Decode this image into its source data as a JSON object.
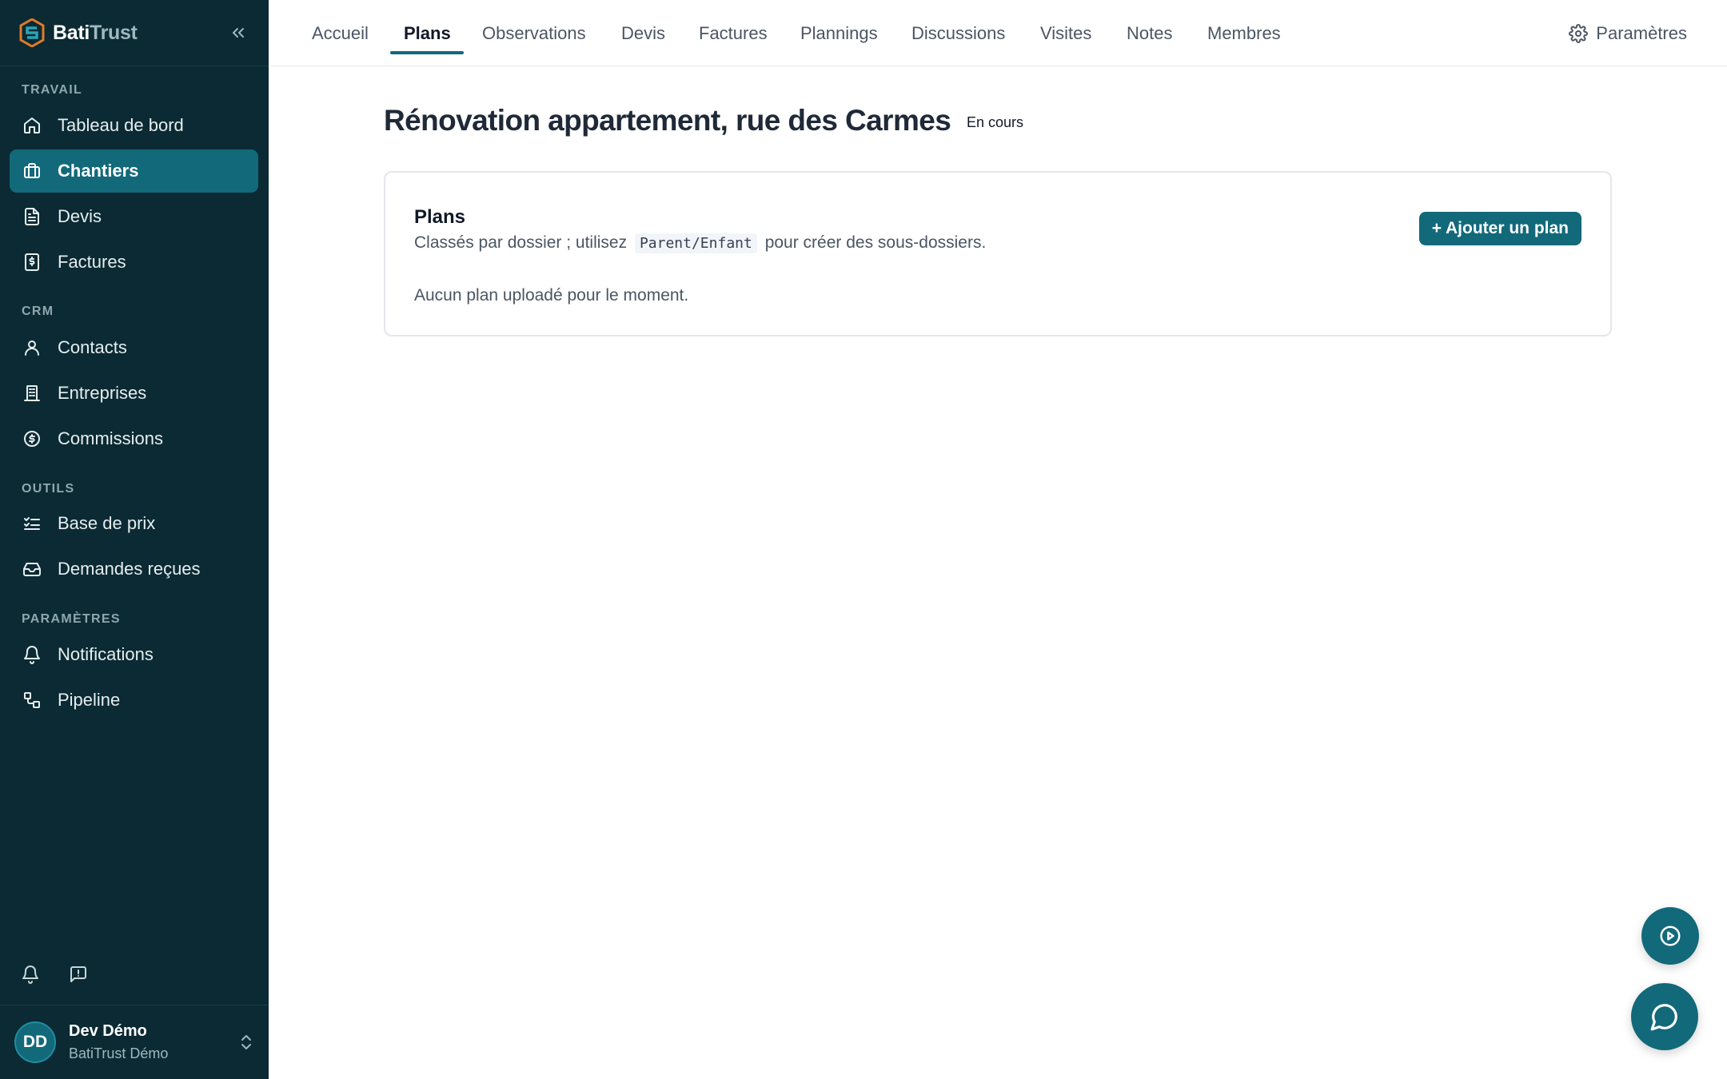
{
  "brand": {
    "name_part1": "Bati",
    "name_part2": "Trust"
  },
  "sidebar": {
    "sections": [
      {
        "label": "TRAVAIL"
      },
      {
        "label": "CRM"
      },
      {
        "label": "OUTILS"
      },
      {
        "label": "PARAMÈTRES"
      }
    ],
    "items": [
      {
        "label": "Tableau de bord",
        "icon": "home-icon"
      },
      {
        "label": "Chantiers",
        "icon": "briefcase-icon",
        "active": true
      },
      {
        "label": "Devis",
        "icon": "file-text-icon"
      },
      {
        "label": "Factures",
        "icon": "receipt-icon"
      },
      {
        "label": "Contacts",
        "icon": "user-icon"
      },
      {
        "label": "Entreprises",
        "icon": "building-icon"
      },
      {
        "label": "Commissions",
        "icon": "dollar-circle-icon"
      },
      {
        "label": "Base de prix",
        "icon": "list-check-icon"
      },
      {
        "label": "Demandes reçues",
        "icon": "inbox-icon"
      },
      {
        "label": "Notifications",
        "icon": "bell-icon"
      },
      {
        "label": "Pipeline",
        "icon": "workflow-icon"
      }
    ]
  },
  "user": {
    "initials": "DD",
    "name": "Dev Démo",
    "org": "BatiTrust Démo"
  },
  "tabs": [
    {
      "label": "Accueil"
    },
    {
      "label": "Plans",
      "active": true
    },
    {
      "label": "Observations"
    },
    {
      "label": "Devis"
    },
    {
      "label": "Factures"
    },
    {
      "label": "Plannings"
    },
    {
      "label": "Discussions"
    },
    {
      "label": "Visites"
    },
    {
      "label": "Notes"
    },
    {
      "label": "Membres"
    }
  ],
  "settings_label": "Paramètres",
  "project": {
    "title": "Rénovation appartement, rue des Carmes",
    "status": "En cours"
  },
  "plans_card": {
    "title": "Plans",
    "subtitle_before": "Classés par dossier ; utilisez",
    "subtitle_code": "Parent/Enfant",
    "subtitle_after": "pour créer des sous-dossiers.",
    "empty_text": "Aucun plan uploadé pour le moment.",
    "add_button": "+ Ajouter un plan"
  },
  "colors": {
    "sidebar_bg": "#0b2a33",
    "accent": "#12697a"
  }
}
